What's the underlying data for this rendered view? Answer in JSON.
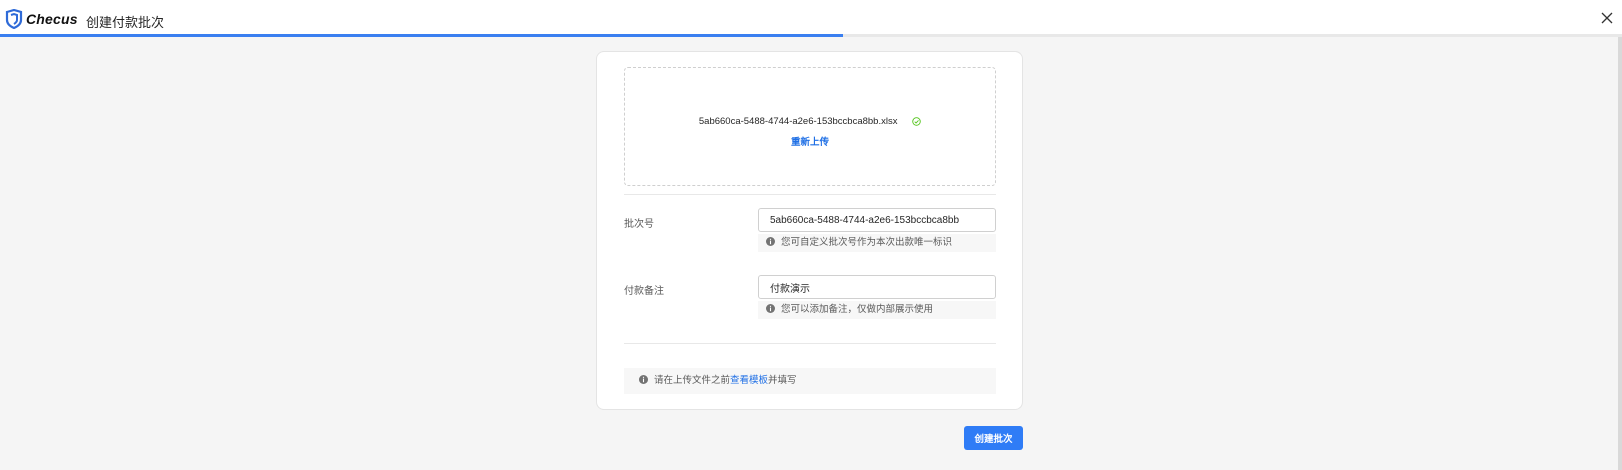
{
  "header": {
    "brand": "Checus",
    "title": "创建付款批次",
    "logo_icon": "checus-logo-icon",
    "close_icon": "close-icon"
  },
  "progress": {
    "percent": 52,
    "color": "#3a7ff0"
  },
  "upload": {
    "file_name": "5ab660ca-5488-4744-a2e6-153bccbca8bb.xlsx",
    "status_icon": "check-circle-icon",
    "status_color": "#52c41a",
    "reupload_label": "重新上传"
  },
  "fields": {
    "batch_no": {
      "label": "批次号",
      "value": "5ab660ca-5488-4744-a2e6-153bccbca8bb",
      "hint": "您可自定义批次号作为本次出款唯一标识"
    },
    "remark": {
      "label": "付款备注",
      "value": "付款演示",
      "hint": "您可以添加备注，仅做内部展示使用"
    }
  },
  "notice": {
    "prefix": "请在上传文件之前",
    "link": "查看模板",
    "suffix": "并填写"
  },
  "actions": {
    "create_label": "创建批次",
    "accent": "#2f7cf6"
  }
}
